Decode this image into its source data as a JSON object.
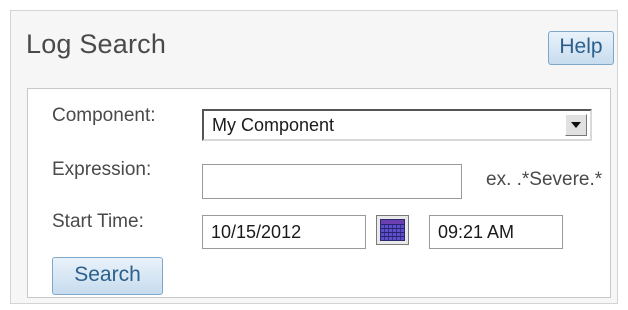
{
  "header": {
    "title": "Log Search",
    "help_label": "Help"
  },
  "form": {
    "component_label": "Component:",
    "component_value": "My Component",
    "expression_label": "Expression:",
    "expression_value": "",
    "expression_hint": "ex. .*Severe.*",
    "start_time_label": "Start Time:",
    "start_date": "10/15/2012",
    "start_time": "09:21 AM",
    "calendar_icon": "calendar-icon",
    "search_label": "Search"
  },
  "colors": {
    "button_text": "#2c5f8c",
    "button_border": "#7fa7c9",
    "panel_bg": "#f6f6f6",
    "label_text": "#4a4a4a"
  }
}
